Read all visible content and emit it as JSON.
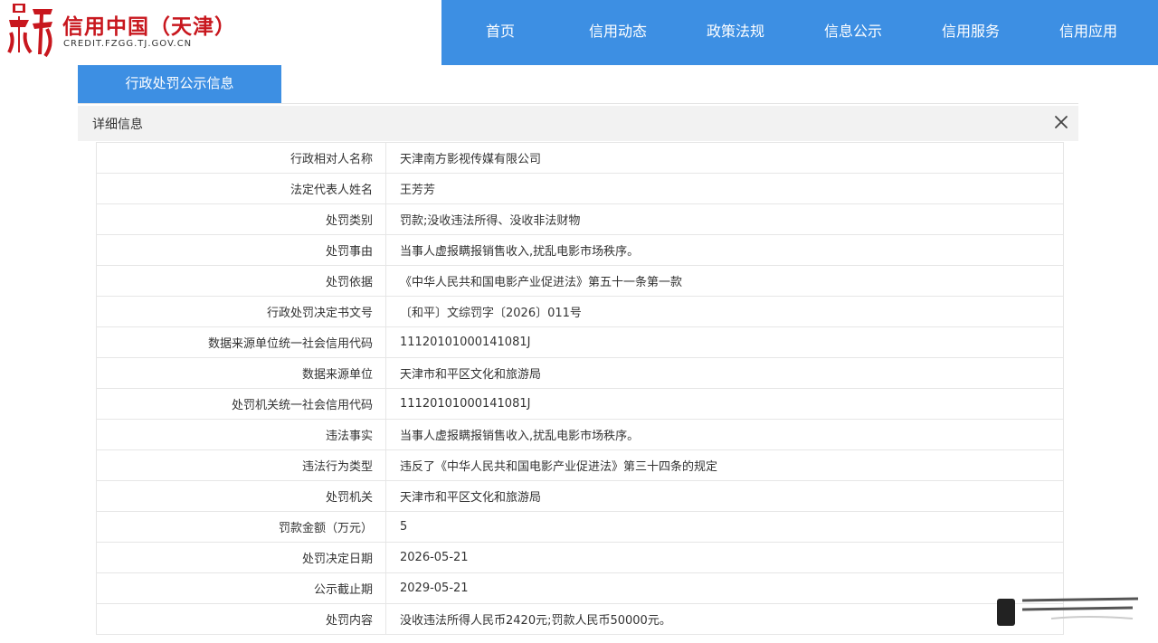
{
  "header": {
    "logo_title": "信用中国（天津）",
    "logo_sub": "CREDIT.FZGG.TJ.GOV.CN",
    "nav": [
      "首页",
      "信用动态",
      "政策法规",
      "信息公示",
      "信用服务",
      "信用应用"
    ]
  },
  "tab": {
    "label": "行政处罚公示信息"
  },
  "panel": {
    "title": "详细信息",
    "close_icon": "close-icon"
  },
  "rows": [
    {
      "label": "行政相对人名称",
      "value": "天津南方影视传媒有限公司"
    },
    {
      "label": "法定代表人姓名",
      "value": "王芳芳"
    },
    {
      "label": "处罚类别",
      "value": "罚款;没收违法所得、没收非法财物"
    },
    {
      "label": "处罚事由",
      "value": "当事人虚报瞒报销售收入,扰乱电影市场秩序。"
    },
    {
      "label": "处罚依据",
      "value": "《中华人民共和国电影产业促进法》第五十一条第一款"
    },
    {
      "label": "行政处罚决定书文号",
      "value": "〔和平〕文综罚字〔2026〕011号"
    },
    {
      "label": "数据来源单位统一社会信用代码",
      "value": "11120101000141081J"
    },
    {
      "label": "数据来源单位",
      "value": "天津市和平区文化和旅游局"
    },
    {
      "label": "处罚机关统一社会信用代码",
      "value": "11120101000141081J"
    },
    {
      "label": "违法事实",
      "value": "当事人虚报瞒报销售收入,扰乱电影市场秩序。"
    },
    {
      "label": "违法行为类型",
      "value": "违反了《中华人民共和国电影产业促进法》第三十四条的规定"
    },
    {
      "label": "处罚机关",
      "value": "天津市和平区文化和旅游局"
    },
    {
      "label": "罚款金额（万元）",
      "value": "5"
    },
    {
      "label": "处罚决定日期",
      "value": "2026-05-21"
    },
    {
      "label": "公示截止期",
      "value": "2029-05-21"
    },
    {
      "label": "处罚内容",
      "value": "没收违法所得人民币2420元;罚款人民币50000元。"
    }
  ],
  "colors": {
    "nav_bg": "#3d8fe3",
    "brand_red": "#c8171e",
    "panel_bg": "#f2f2f2"
  }
}
